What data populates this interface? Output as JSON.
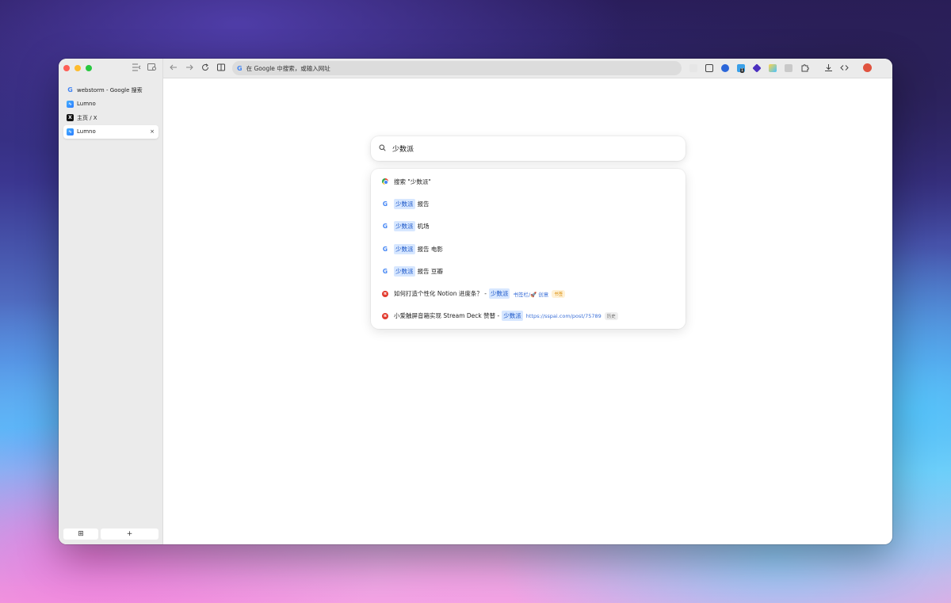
{
  "sidebar": {
    "tabs": [
      {
        "title": "webstorm - Google 搜索",
        "favicon": "google-icon"
      },
      {
        "title": "Lumno",
        "favicon": "lumno-icon"
      },
      {
        "title": "主页 / X",
        "favicon": "x-icon"
      },
      {
        "title": "Lumno",
        "favicon": "lumno-icon",
        "active": true
      }
    ],
    "close_glyph": "×",
    "grid_glyph": "⊞",
    "new_tab_glyph": "+"
  },
  "toolbar": {
    "omnibox_placeholder": "在 Google 中搜索，或输入网址",
    "google_glyph": "G",
    "ext_badge": "1"
  },
  "search": {
    "query": "少数派"
  },
  "suggestions": [
    {
      "icon": "chrome-icon",
      "text": "搜索 \"少数派\""
    },
    {
      "icon": "google-icon",
      "highlight": "少数派",
      "rest": "报告"
    },
    {
      "icon": "google-icon",
      "highlight": "少数派",
      "rest": "机场"
    },
    {
      "icon": "google-icon",
      "highlight": "少数派",
      "rest": "报告 电影"
    },
    {
      "icon": "google-icon",
      "highlight": "少数派",
      "rest": "报告 豆瓣"
    },
    {
      "icon": "sspai-icon",
      "prefix": "如何打造个性化 Notion 进度条？ -",
      "highlight": "少数派",
      "meta": "书签栏/🚀 创意",
      "badge": "书签"
    },
    {
      "icon": "sspai-icon",
      "prefix": "小爱触屏音箱实现 Stream Deck 赞替 -",
      "highlight": "少数派",
      "meta": "https://sspai.com/post/75789",
      "badge": "历史"
    }
  ],
  "colors": {
    "accent": "#1a56c8",
    "highlight_bg": "#d7e7ff",
    "bookmark_badge": "#d98a00"
  }
}
